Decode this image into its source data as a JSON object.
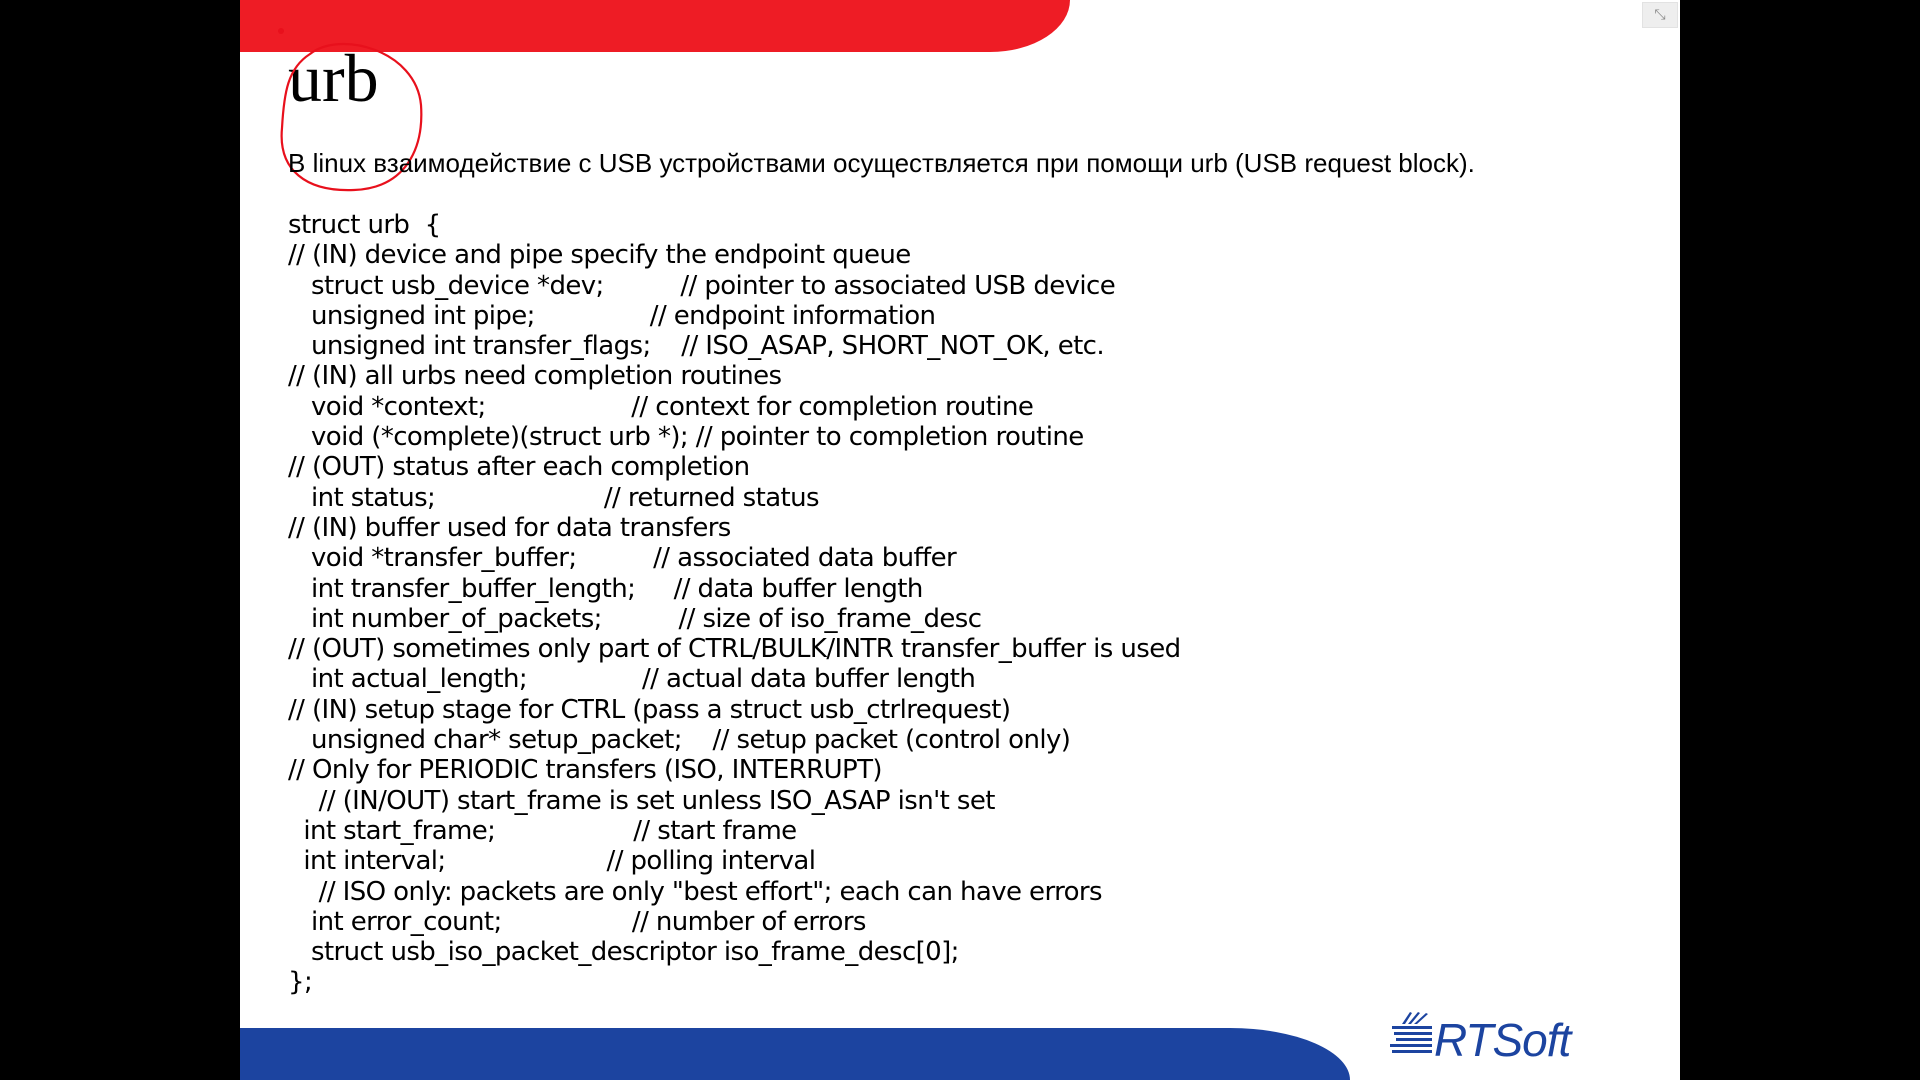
{
  "slide": {
    "title": "urb",
    "intro": "В linux взаимодействие с USB устройствами осуществляется при помощи urb (USB request block).",
    "code_lines": [
      "struct urb  {",
      "// (IN) device and pipe specify the endpoint queue",
      "   struct usb_device *dev;          // pointer to associated USB device",
      "   unsigned int pipe;               // endpoint information",
      "   unsigned int transfer_flags;    // ISO_ASAP, SHORT_NOT_OK, etc.",
      "// (IN) all urbs need completion routines",
      "   void *context;                   // context for completion routine",
      "   void (*complete)(struct urb *); // pointer to completion routine",
      "// (OUT) status after each completion",
      "   int status;                      // returned status",
      "// (IN) buffer used for data transfers",
      "   void *transfer_buffer;          // associated data buffer",
      "   int transfer_buffer_length;     // data buffer length",
      "   int number_of_packets;          // size of iso_frame_desc",
      "// (OUT) sometimes only part of CTRL/BULK/INTR transfer_buffer is used",
      "   int actual_length;               // actual data buffer length",
      "// (IN) setup stage for CTRL (pass a struct usb_ctrlrequest)",
      "   unsigned char* setup_packet;    // setup packet (control only)",
      "// Only for PERIODIC transfers (ISO, INTERRUPT)",
      "    // (IN/OUT) start_frame is set unless ISO_ASAP isn't set",
      "  int start_frame;                  // start frame",
      "  int interval;                     // polling interval",
      "    // ISO only: packets are only \"best effort\"; each can have errors",
      "   int error_count;                 // number of errors",
      "   struct usb_iso_packet_descriptor iso_frame_desc[0];",
      "};"
    ]
  },
  "logo": {
    "text": "RTSoft"
  },
  "window_controls": {
    "restore_icon": "⤡"
  },
  "colors": {
    "red_banner": "#ee1c25",
    "blue_banner": "#1c44a0",
    "annotation": "#e8101c",
    "logo_blue": "#1c44a0",
    "background": "#000000",
    "slide": "#ffffff"
  }
}
